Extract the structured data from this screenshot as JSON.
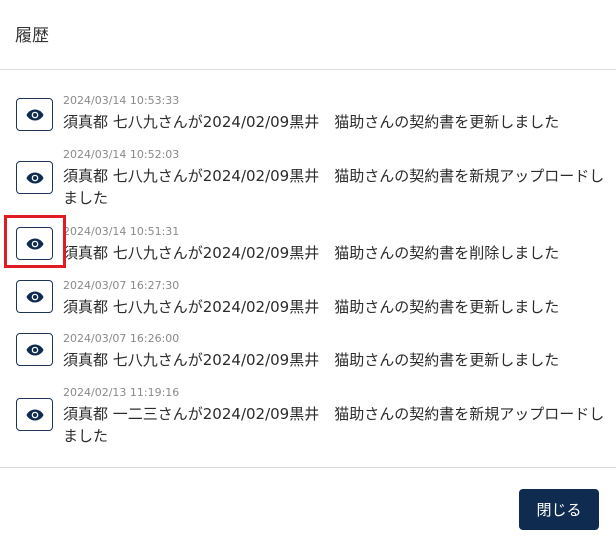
{
  "dialog": {
    "title": "履歴",
    "close_label": "閉じる"
  },
  "entries": [
    {
      "timestamp": "2024/03/14 10:53:33",
      "message": "須真都 七八九さんが2024/02/09黒井　猫助さんの契約書を更新しました",
      "icon": "eye-icon"
    },
    {
      "timestamp": "2024/03/14 10:52:03",
      "message": "須真都 七八九さんが2024/02/09黒井　猫助さんの契約書を新規アップロードしました",
      "icon": "eye-icon"
    },
    {
      "timestamp": "2024/03/14 10:51:31",
      "message": "須真都 七八九さんが2024/02/09黒井　猫助さんの契約書を削除しました",
      "icon": "eye-icon",
      "highlighted": true
    },
    {
      "timestamp": "2024/03/07 16:27:30",
      "message": "須真都 七八九さんが2024/02/09黒井　猫助さんの契約書を更新しました",
      "icon": "eye-icon"
    },
    {
      "timestamp": "2024/03/07 16:26:00",
      "message": "須真都 七八九さんが2024/02/09黒井　猫助さんの契約書を更新しました",
      "icon": "eye-icon"
    },
    {
      "timestamp": "2024/02/13 11:19:16",
      "message": "須真都 一二三さんが2024/02/09黒井　猫助さんの契約書を新規アップロードしました",
      "icon": "eye-icon"
    }
  ],
  "colors": {
    "primary": "#0f2b4f",
    "highlight": "#e01b24",
    "timestamp": "#8a8a8a"
  }
}
